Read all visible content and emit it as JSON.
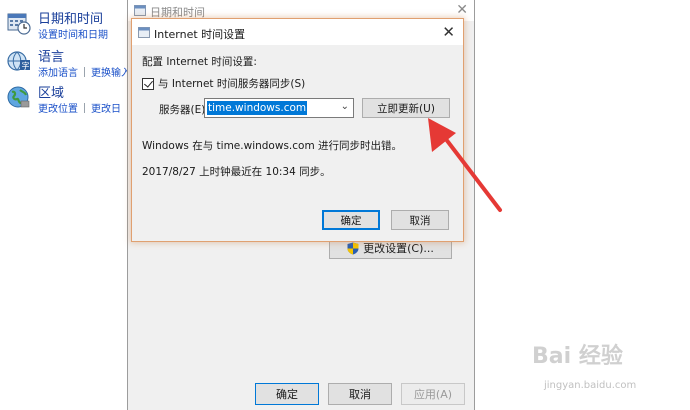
{
  "control_panel": {
    "items": [
      {
        "title": "日期和时间",
        "links": [
          "设置时间和日期"
        ],
        "icon": "calendar-clock-icon"
      },
      {
        "title": "语言",
        "links": [
          "添加语言",
          "更换输入"
        ],
        "icon": "language-icon"
      },
      {
        "title": "区域",
        "links": [
          "更改位置",
          "更改日"
        ],
        "icon": "globe-icon"
      }
    ]
  },
  "background_window": {
    "title": "日期和时间",
    "change_settings_label": "更改设置(C)...",
    "ok_label": "确定",
    "cancel_label": "取消",
    "apply_label": "应用(A)"
  },
  "dialog": {
    "title": "Internet 时间设置",
    "heading": "配置 Internet 时间设置:",
    "sync_checkbox_label": "与 Internet 时间服务器同步(S)",
    "sync_checked": true,
    "server_label": "服务器(E):",
    "server_value": "time.windows.com",
    "update_now_label": "立即更新(U)",
    "error_message": "Windows 在与 time.windows.com 进行同步时出错。",
    "last_sync": "2017/8/27 上时钟最近在 10:34 同步。",
    "ok_label": "确定",
    "cancel_label": "取消"
  },
  "annotation": {
    "arrow_color": "#e53935"
  },
  "watermark": {
    "logo": "Bai 经验",
    "url": "jingyan.baidu.com"
  },
  "colors": {
    "accent": "#0078d7",
    "link": "#1a50c8",
    "title_link": "#1a3f9a"
  }
}
